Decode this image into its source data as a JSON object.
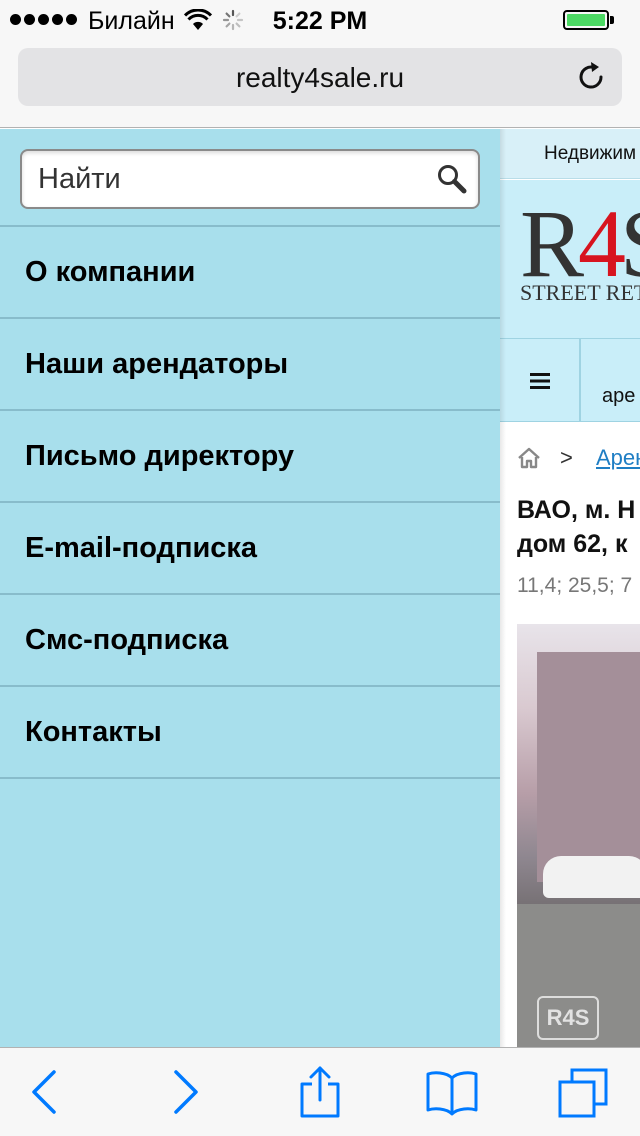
{
  "status_bar": {
    "carrier": "Билайн",
    "time": "5:22 PM",
    "signal_bars": 5,
    "battery_level": 1.0,
    "colors": {
      "battery": "#4cd964"
    }
  },
  "browser": {
    "url": "realty4sale.ru",
    "reload_icon": "reload-icon"
  },
  "side_menu": {
    "search_placeholder": "Найти",
    "items": [
      {
        "label": "О компании"
      },
      {
        "label": "Наши арендаторы"
      },
      {
        "label": "Письмо директору"
      },
      {
        "label": "E-mail-подписка"
      },
      {
        "label": "Смс-подписка"
      },
      {
        "label": "Контакты"
      }
    ],
    "colors": {
      "background": "#a8dfec",
      "divider": "#88bccb"
    }
  },
  "page": {
    "top_strip": "Недвижим",
    "logo": {
      "prefix": "R",
      "accent": "4",
      "suffix": "S",
      "subtitle": "STREET RET"
    },
    "nav_text": "аре",
    "breadcrumb": {
      "separator": ">",
      "link": "Аренд"
    },
    "title_lines": [
      "ВАО, м. Н",
      "дом 62, к"
    ],
    "meta": "11,4; 25,5; 7",
    "photo_watermark": "R4S",
    "colors": {
      "logo_accent": "#d7141f",
      "link": "#1f7ec4"
    }
  },
  "toolbar": {
    "icons": [
      "back-icon",
      "forward-icon",
      "share-icon",
      "bookmarks-icon",
      "tabs-icon"
    ],
    "colors": {
      "icon": "#007aff"
    }
  }
}
